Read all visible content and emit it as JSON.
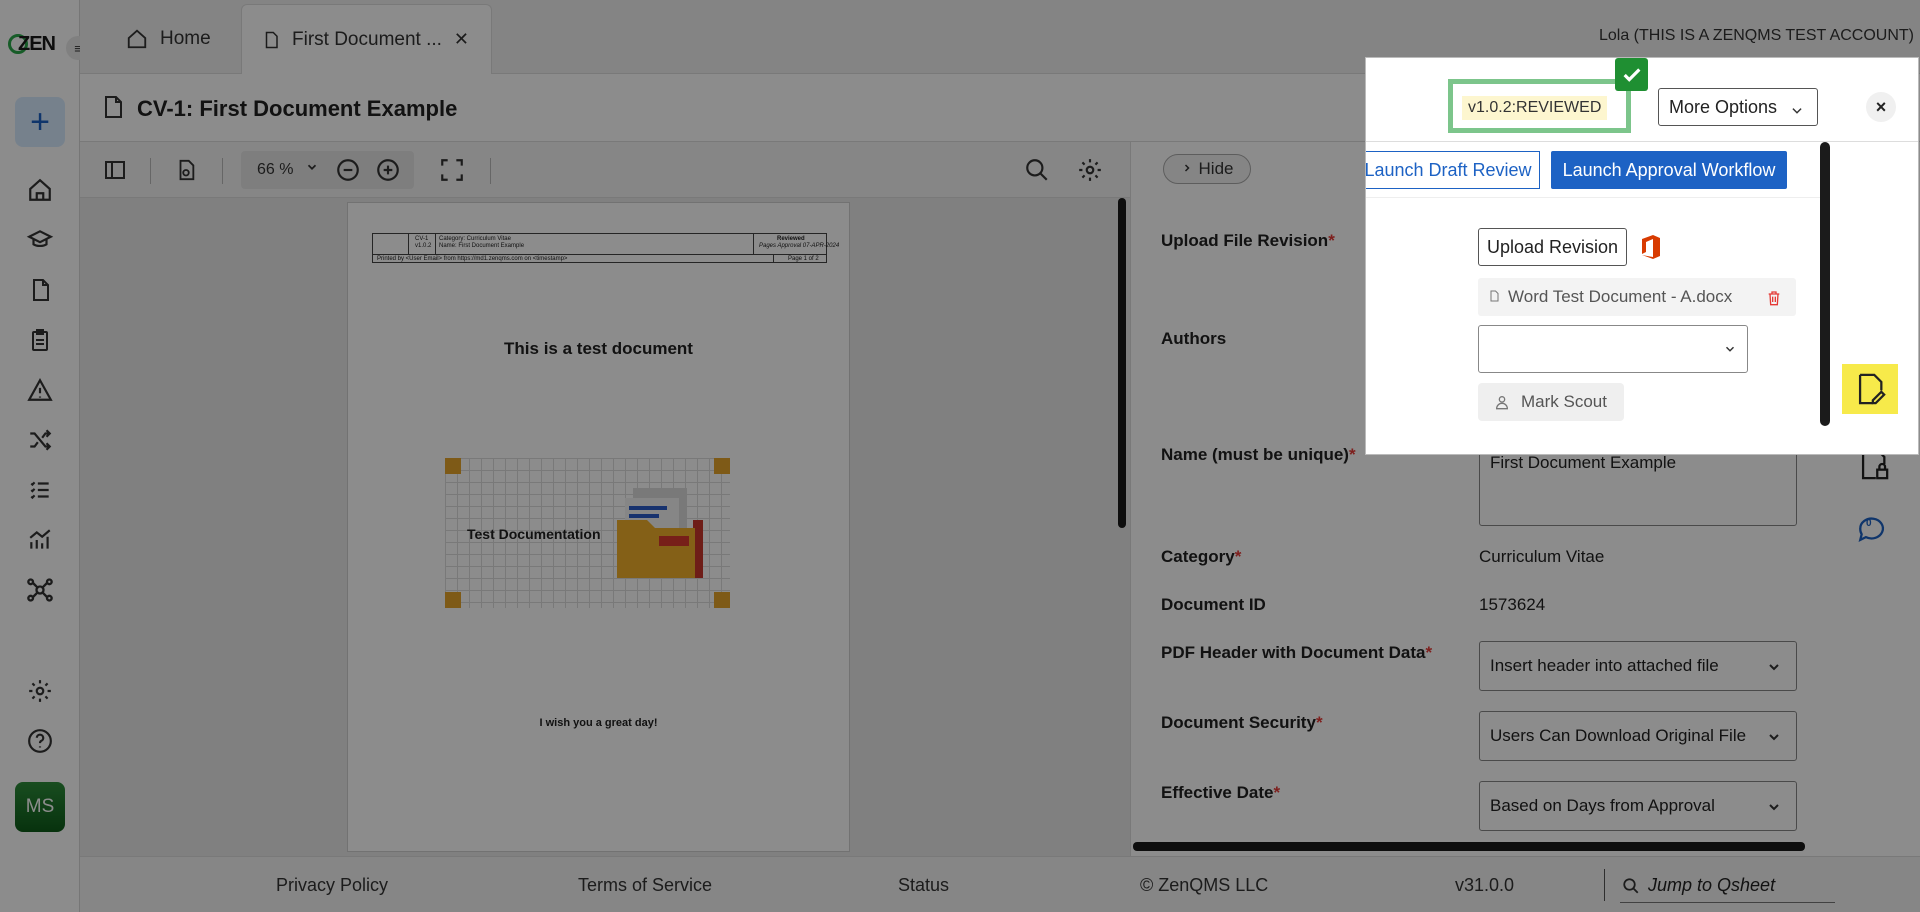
{
  "tabs": {
    "home": "Home",
    "document": "First Document ..."
  },
  "user": {
    "name": "Lola (THIS IS A ZENQMS TEST ACCOUNT)",
    "initials": "MS"
  },
  "logo": "ZEN",
  "page_title": "CV-1: First Document Example",
  "toolbar": {
    "zoom": "66 %"
  },
  "document_page": {
    "header": {
      "id": "CV-1",
      "version": "v1.0.2",
      "category": "Category: Curriculum Vitae",
      "name": "Name: First Document Example",
      "status": "Reviewed",
      "pending": "Pages Approval 07-APR-2024",
      "printed_by": "Printed by <User Email> from https://md1.zenqms.com on <timestamp>",
      "page": "Page 1 of 2"
    },
    "heading": "This is a test document",
    "illustration_label": "Test Documentation",
    "footer_text": "I wish you a great day!"
  },
  "panel": {
    "hide_label": "Hide",
    "version_badge": "v1.0.2:REVIEWED",
    "more_options": "More Options",
    "close": "×",
    "launch_draft_review": "Launch Draft Review",
    "launch_approval_workflow": "Launch Approval Workflow"
  },
  "form": {
    "upload_label": "Upload File Revision",
    "upload_button": "Upload Revision",
    "file_name": "Word Test Document - A.docx",
    "authors_label": "Authors",
    "author_select_value": "",
    "author_chip": "Mark Scout",
    "name_label": "Name (must be unique)",
    "name_value": "First Document Example",
    "category_label": "Category",
    "category_value": "Curriculum Vitae",
    "document_id_label": "Document ID",
    "document_id_value": "1573624",
    "pdf_header_label": "PDF Header with Document Data",
    "pdf_header_value": "Insert header into attached file",
    "security_label": "Document Security",
    "security_value": "Users Can Download Original File",
    "effective_label": "Effective Date",
    "effective_value": "Based on Days from Approval",
    "required_marker": "*"
  },
  "comments_count": "0",
  "footer": {
    "privacy": "Privacy Policy",
    "terms": "Terms of Service",
    "status": "Status",
    "copyright": "© ZenQMS LLC",
    "version": "v31.0.0",
    "jump": "Jump to Qsheet"
  },
  "colors": {
    "accent": "#1d62c4",
    "success": "#1f8f32",
    "highlight": "#f7ea4a",
    "required": "#e53935",
    "version_border": "#7cc58b"
  }
}
